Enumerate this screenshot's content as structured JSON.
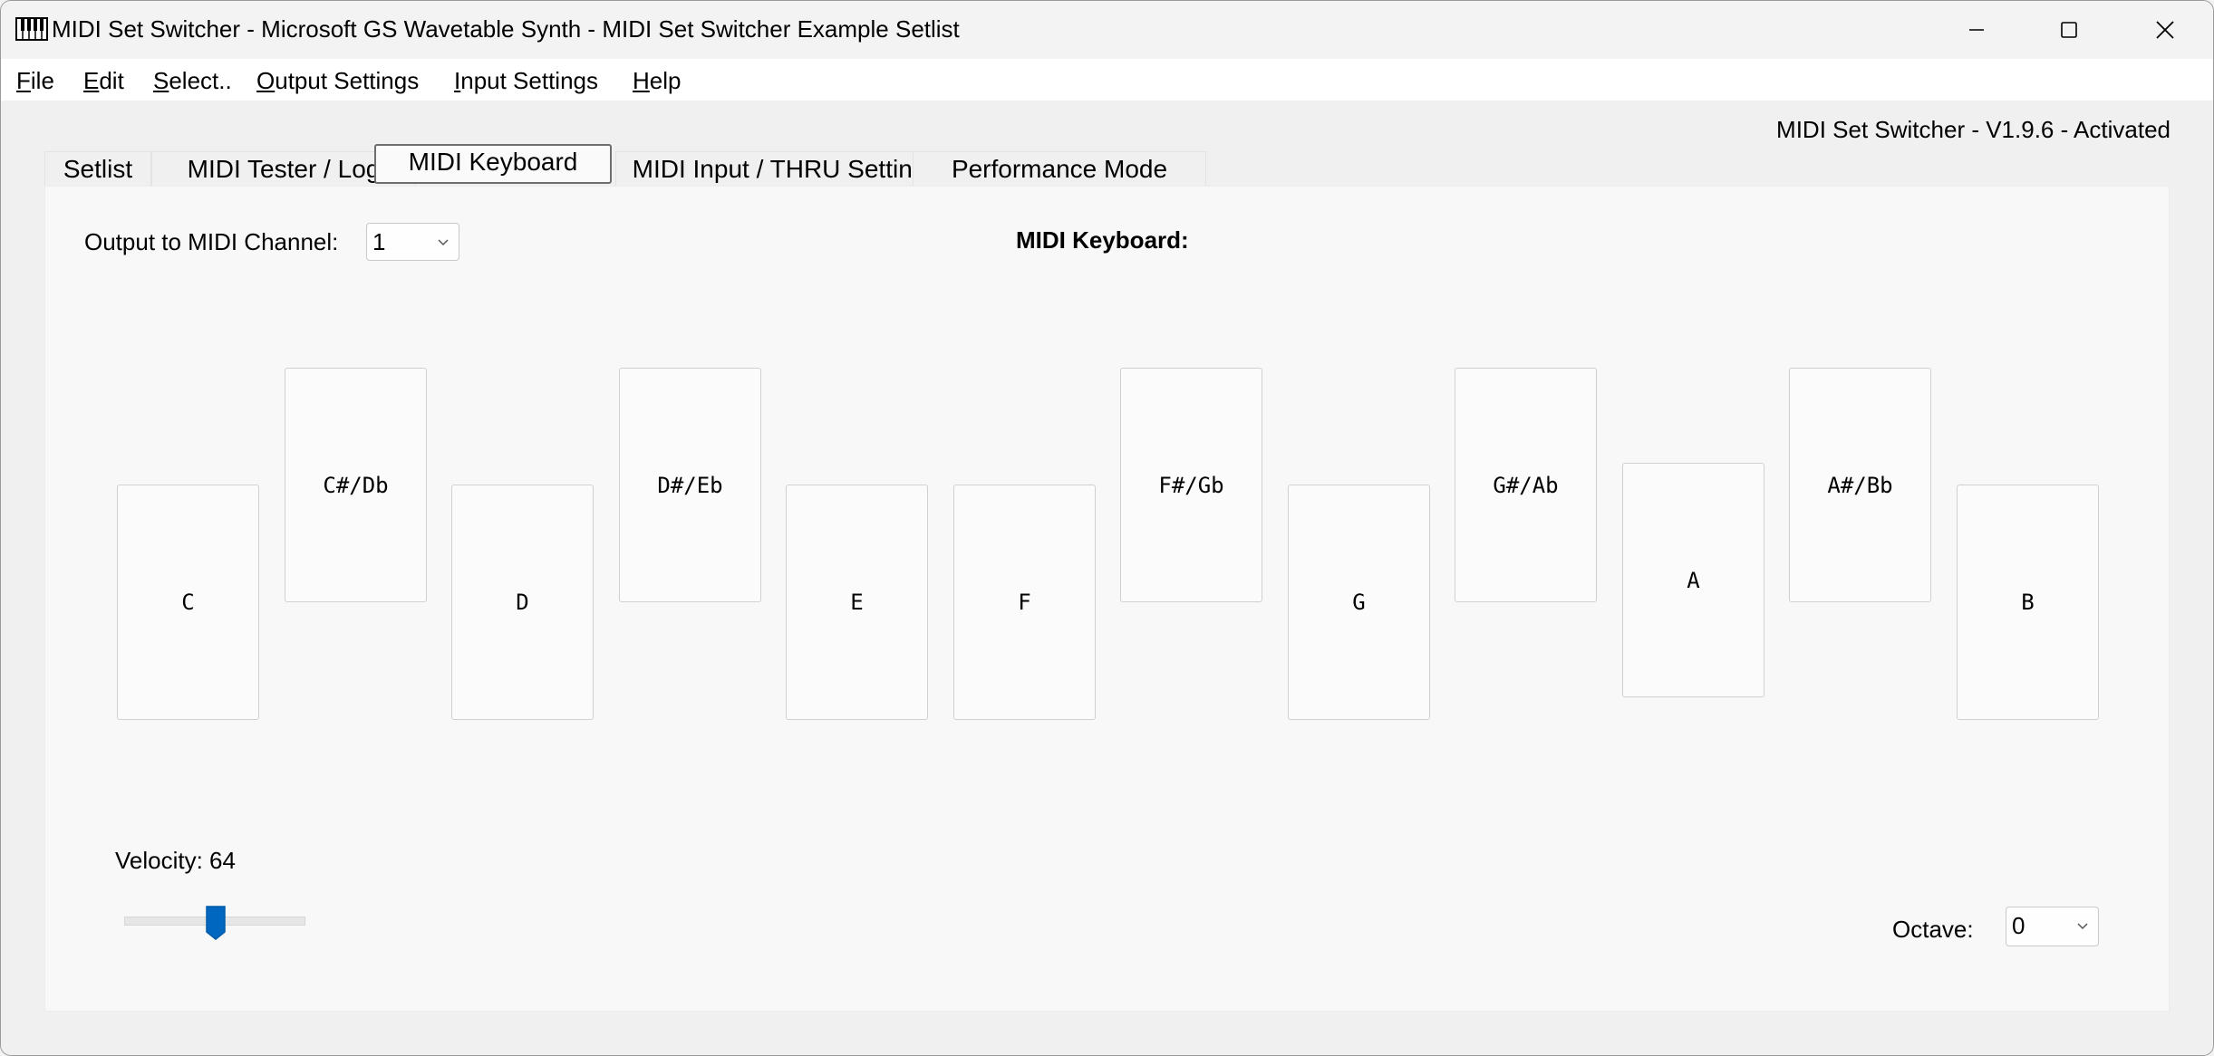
{
  "window": {
    "title": "MIDI Set Switcher - Microsoft GS Wavetable Synth - MIDI Set Switcher Example Setlist",
    "app_icon": "piano-keyboard-icon"
  },
  "menu": {
    "file": {
      "prefix": "",
      "underline": "F",
      "rest": "ile"
    },
    "edit": {
      "prefix": "",
      "underline": "E",
      "rest": "dit"
    },
    "select": {
      "prefix": "",
      "underline": "S",
      "rest": "elect.."
    },
    "output": {
      "prefix": "",
      "underline": "O",
      "rest": "utput Settings"
    },
    "input": {
      "prefix": "",
      "underline": "I",
      "rest": "nput Settings"
    },
    "help": {
      "prefix": "",
      "underline": "H",
      "rest": "elp"
    }
  },
  "version_text": "MIDI Set Switcher - V1.9.6 - Activated",
  "tabs": [
    {
      "label": "Setlist",
      "active": false
    },
    {
      "label": "MIDI Tester / Log",
      "active": false
    },
    {
      "label": "MIDI Keyboard",
      "active": true
    },
    {
      "label": "MIDI Input / THRU Settings",
      "active": false
    },
    {
      "label": "Performance Mode",
      "active": false
    }
  ],
  "keyboard_tab": {
    "channel_label": "Output to MIDI Channel:",
    "channel_value": "1",
    "heading": "MIDI Keyboard:",
    "keys": [
      "C",
      "C#/Db",
      "D",
      "D#/Eb",
      "E",
      "F",
      "F#/Gb",
      "G",
      "G#/Ab",
      "A",
      "A#/Bb",
      "B"
    ],
    "velocity_label": "Velocity: 64",
    "velocity_value": 64,
    "velocity_max": 127,
    "octave_label": "Octave:",
    "octave_value": "0"
  },
  "colors": {
    "accent": "#0067c0"
  }
}
